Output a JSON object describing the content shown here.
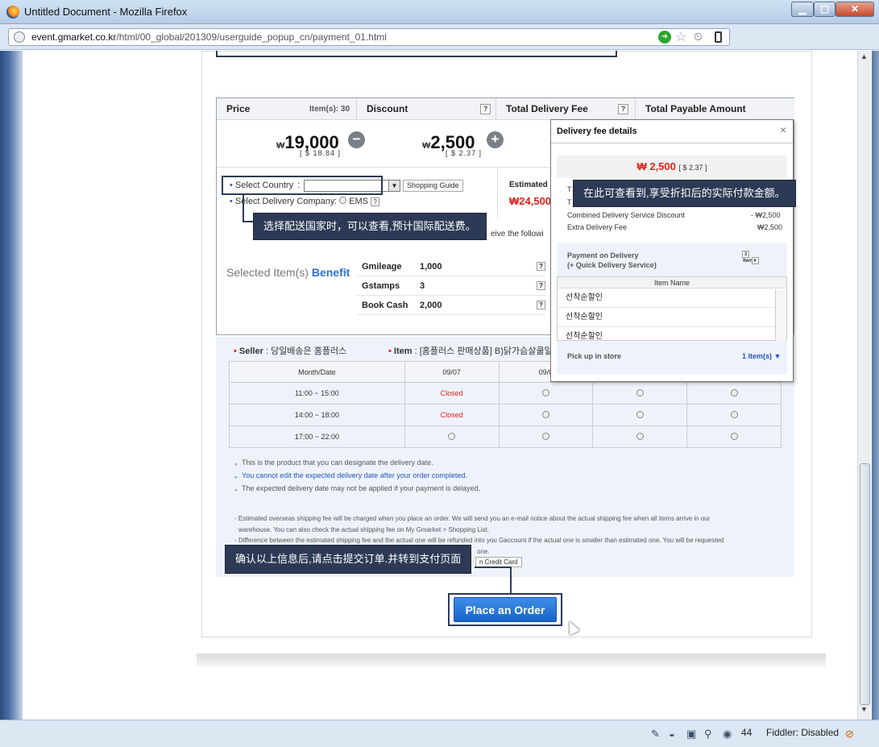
{
  "window": {
    "title": "Untitled Document - Mozilla Firefox",
    "url_host": "event.gmarket.co.kr",
    "url_prefix": "",
    "url_path": "/html/00_global/201309/userguide_popup_cn/payment_01.html"
  },
  "statusbar": {
    "count": "44",
    "fiddler": "Fiddler: Disabled"
  },
  "summary": {
    "price_label": "Price",
    "item_count": "Item(s): 30",
    "discount_label": "Discount",
    "delivery_label": "Total Delivery Fee",
    "payable_label": "Total Payable Amount",
    "price_value": "19,000",
    "price_usd": "[ $ 18.84 ]",
    "discount_value": "2,500",
    "discount_usd": "[ $ 2.37 ]",
    "won_sign": "₩",
    "minus": "−",
    "plus": "+",
    "hint": "?"
  },
  "options": {
    "country_label": "Select Country",
    "colon": ":",
    "shopping_guide": "Shopping Guide",
    "company_label": "Select Delivery Company",
    "ems": "EMS",
    "estimated": "Estimated c",
    "estimated_value": "₩24,500",
    "receive_text": "eive the followi"
  },
  "benefit": {
    "title": "Selected Item(s)",
    "title_blue": "Benefit",
    "rows": [
      {
        "name": "Gmileage",
        "value": "1,000"
      },
      {
        "name": "Gstamps",
        "value": "3"
      },
      {
        "name": "Book Cash",
        "value": "2,000"
      }
    ]
  },
  "seller": {
    "seller_label": "Seller",
    "seller_value": ": 당일배송은 홈플러스",
    "item_label": "Item",
    "item_value": ": [홈플러스 판매상품] B)닭가슴살쿨알리"
  },
  "delivery_table": {
    "header": [
      "Month/Date",
      "09/07",
      "09/0",
      "",
      ""
    ],
    "rows": [
      {
        "time": "11:00 ~ 15:00",
        "cells": [
          "Closed",
          "radio",
          "radio",
          "radio"
        ]
      },
      {
        "time": "14:00 ~ 18:00",
        "cells": [
          "Closed",
          "radio",
          "radio",
          "radio"
        ]
      },
      {
        "time": "17:00 ~ 22:00",
        "cells": [
          "radio",
          "radio",
          "radio",
          "radio"
        ]
      }
    ]
  },
  "notes": {
    "n1": "This is the product that you can designate the delivery date.",
    "n2": "You cannot edit the expected delivery date after your order completed.",
    "n3": "The expected delivery date may not be applied if your payment is delayed.",
    "p1": "- Estimated overseas shipping fee will be charged when you place an order. We will send you an e-mail notice about the actual shipping fee when all items arrive in our",
    "p2": "warehouse. You can also check the actual shipping fee on My Gmarket > Shopping List.",
    "p3": "- Difference between the estimated shipping fee and the actual one will be refunded into you Gaccount if the actual one is smaller than estimated one. You will be requested",
    "p4": "one.",
    "credit_card": "n Credit Card"
  },
  "popup": {
    "title": "Delivery fee details",
    "close": "×",
    "total": "₩ 2,500",
    "total_usd": "[ $ 2.37 ]",
    "line1_label": "T",
    "line2_label": "T",
    "discount_label": "Combined Delivery Service Discount",
    "discount_amt": "- ₩2,500",
    "extra_label": "Extra Delivery Fee",
    "extra_amt": "₩2,500",
    "pod_label1": "Payment on Delivery",
    "pod_label2": "(+ Quick Delivery Service)",
    "pod_items": "3 Item(s)",
    "item_name_header": "Item Name",
    "items": [
      "선착순할인",
      "선착순할인",
      "선착순할인"
    ],
    "pickup_label": "Pick up in store",
    "pickup_items": "1 Item(s)"
  },
  "tooltips": {
    "country": "选择配送国家时，可以查看,预计国际配送费。",
    "payment": "在此可查看到,享受折扣后的实际付款金额。",
    "order": "确认以上信息后,请点击提交订单.并转到支付页面"
  },
  "order_button": "Place an Order"
}
